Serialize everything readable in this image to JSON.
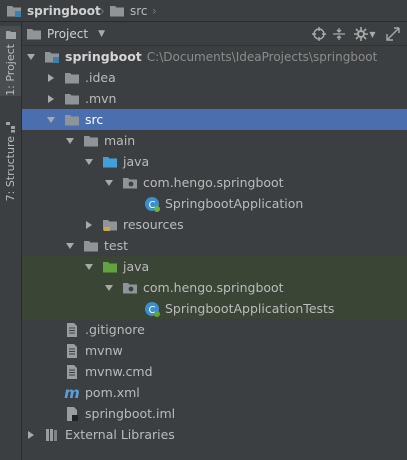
{
  "breadcrumb": {
    "project": "springboot",
    "folder": "src"
  },
  "tool_strip": {
    "project_tab": "1: Project",
    "structure_tab": "7: Structure"
  },
  "panel": {
    "view_label": "Project"
  },
  "tree": {
    "root": {
      "name": "springboot",
      "path": "C:\\Documents\\IdeaProjects\\springboot"
    },
    "idea": ".idea",
    "mvn": ".mvn",
    "src": "src",
    "main": "main",
    "main_java": "java",
    "main_pkg": "com.hengo.springboot",
    "app_class": "SpringbootApplication",
    "resources": "resources",
    "test": "test",
    "test_java": "java",
    "test_pkg": "com.hengo.springboot",
    "test_class": "SpringbootApplicationTests",
    "gitignore": ".gitignore",
    "mvnw": "mvnw",
    "mvnw_cmd": "mvnw.cmd",
    "pom": "pom.xml",
    "iml": "springboot.iml",
    "external": "External Libraries"
  },
  "colors": {
    "selection": "#4b6eaf",
    "test_row": "#3a4536",
    "folder": "#8f9498",
    "source_root": "#40a0d8",
    "test_root": "#62a33f"
  }
}
